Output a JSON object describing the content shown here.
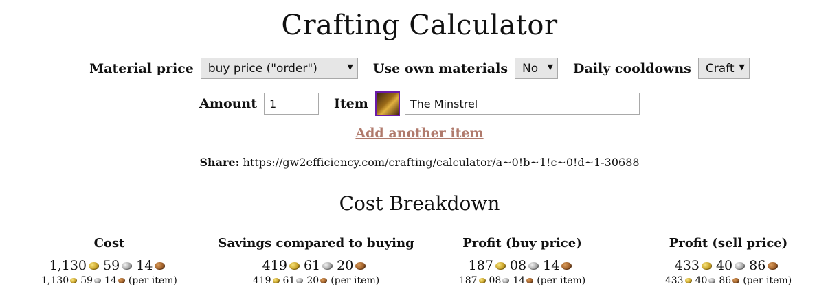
{
  "title": "Crafting Calculator",
  "controls": {
    "material_price": {
      "label": "Material price",
      "value": "buy price (\"order\")"
    },
    "use_own_materials": {
      "label": "Use own materials",
      "value": "No"
    },
    "daily_cooldowns": {
      "label": "Daily cooldowns",
      "value": "Craft"
    },
    "amount": {
      "label": "Amount",
      "value": "1"
    },
    "item": {
      "label": "Item",
      "value": "The Minstrel",
      "icon": "the-minstrel-item-icon"
    }
  },
  "add_item_link": "Add another item",
  "share": {
    "label": "Share:",
    "url": "https://gw2efficiency.com/crafting/calculator/a~0!b~1!c~0!d~1-30688"
  },
  "breakdown": {
    "title": "Cost Breakdown",
    "per_item_suffix": "(per item)",
    "columns": [
      {
        "heading": "Cost",
        "gold": "1,130",
        "silver": "59",
        "copper": "14",
        "per_gold": "1,130",
        "per_silver": "59",
        "per_copper": "14"
      },
      {
        "heading": "Savings compared to buying",
        "gold": "419",
        "silver": "61",
        "copper": "20",
        "per_gold": "419",
        "per_silver": "61",
        "per_copper": "20"
      },
      {
        "heading": "Profit (buy price)",
        "gold": "187",
        "silver": "08",
        "copper": "14",
        "per_gold": "187",
        "per_silver": "08",
        "per_copper": "14"
      },
      {
        "heading": "Profit (sell price)",
        "gold": "433",
        "silver": "40",
        "copper": "86",
        "per_gold": "433",
        "per_silver": "40",
        "per_copper": "86"
      }
    ]
  },
  "colors": {
    "link": "#b07a6c",
    "item_border": "#6a1aa8"
  }
}
